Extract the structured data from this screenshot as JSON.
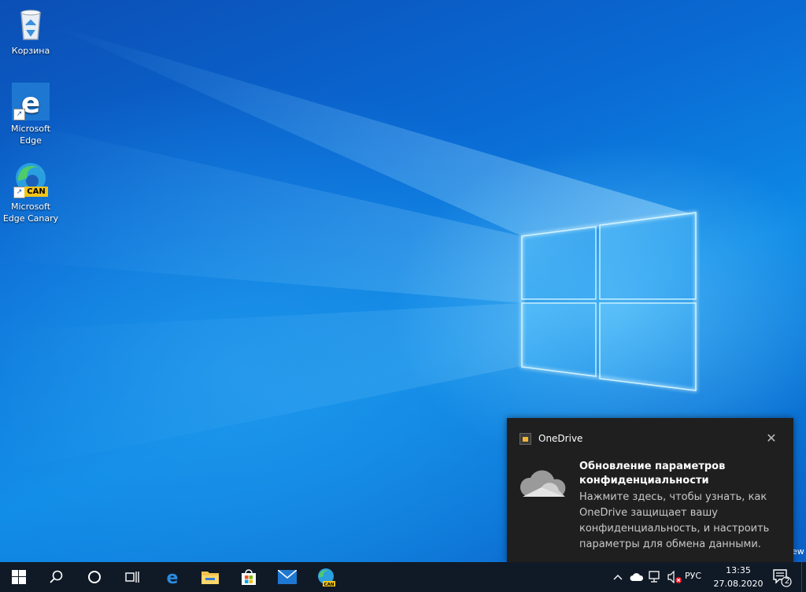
{
  "desktop": {
    "icons": [
      {
        "label": "Корзина",
        "icon": "recycle-bin-icon"
      },
      {
        "label": "Microsoft Edge",
        "icon": "edge-legacy-icon"
      },
      {
        "label": "Microsoft Edge Canary",
        "icon": "edge-canary-icon",
        "badge": "CAN"
      }
    ],
    "edge_text": "ew"
  },
  "toast": {
    "app_name": "OneDrive",
    "close_glyph": "✕",
    "title": "Обновление параметров конфиденциальности",
    "body": "Нажмите здесь, чтобы узнать, как OneDrive защищает вашу конфиденциальность, и настроить параметры для обмена данными."
  },
  "taskbar": {
    "pinned": [
      {
        "name": "start-button",
        "icon": "windows-logo-icon"
      },
      {
        "name": "search-button",
        "icon": "search-icon"
      },
      {
        "name": "cortana-button",
        "icon": "cortana-circle-icon"
      },
      {
        "name": "task-view-button",
        "icon": "task-view-icon"
      },
      {
        "name": "edge-legacy-taskbar",
        "icon": "edge-legacy-icon"
      },
      {
        "name": "file-explorer-taskbar",
        "icon": "folder-icon"
      },
      {
        "name": "store-taskbar",
        "icon": "store-icon"
      },
      {
        "name": "mail-taskbar",
        "icon": "mail-icon"
      },
      {
        "name": "edge-canary-taskbar",
        "icon": "edge-canary-icon",
        "badge": "CAN"
      }
    ],
    "tray": {
      "language": "РУС",
      "time": "13:35",
      "date": "27.08.2020",
      "notification_count": "2"
    }
  },
  "colors": {
    "taskbar_bg": "#101a26",
    "toast_bg": "#1f1f1f",
    "accent": "#0a6ad4"
  }
}
